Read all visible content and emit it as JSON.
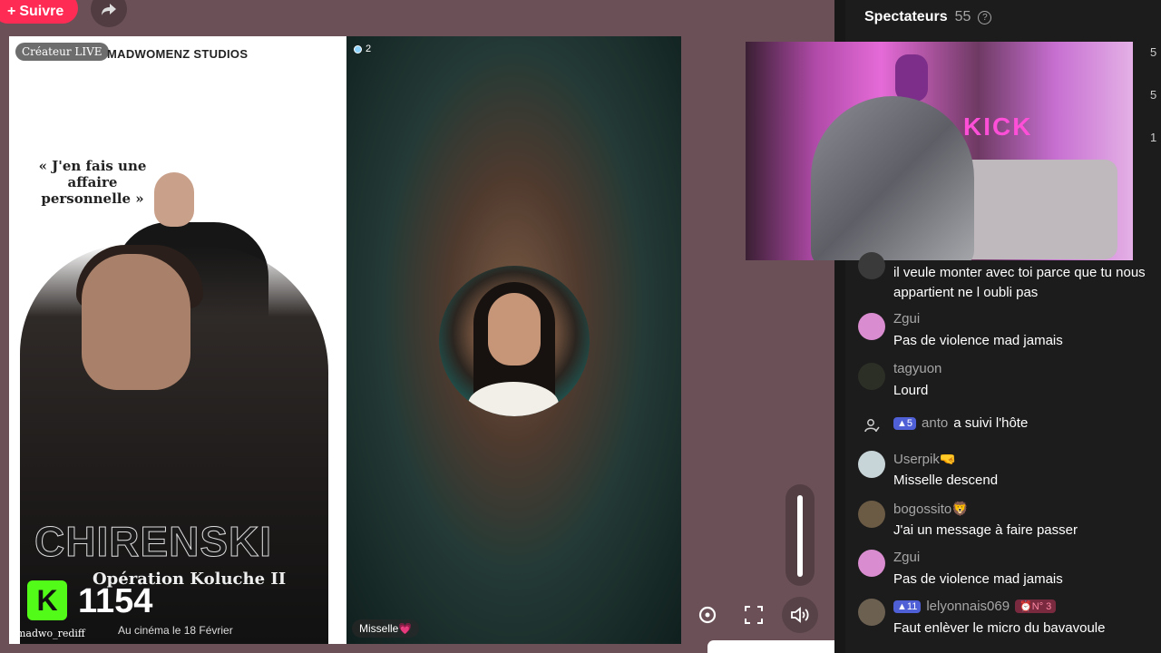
{
  "top": {
    "follow_label": "Suivre"
  },
  "stage_left": {
    "creator_badge": "Créateur LIVE",
    "studio": "MADWOMENZ STUDIOS",
    "quote": "« J'en fais une affaire personnelle »",
    "big_title": "CHIRENSKI",
    "subtitle": "Opération Koluche II",
    "release": "Au cinéma le 18 Février",
    "kick_letter": "K",
    "kick_count": "1154",
    "rediff": "madwo_rediff"
  },
  "stage_right": {
    "viewer_count": "2",
    "guest_name": "Misselle💗"
  },
  "panel": {
    "title": "Spectateurs",
    "viewer_count": "55",
    "rank_side": [
      "5",
      "5",
      "1"
    ]
  },
  "chat": [
    {
      "user": "",
      "text": "il veule monter avec toi parce que tu nous appartient ne l oubli pas",
      "avatar_color": "#3a3a3a"
    },
    {
      "user": "Zgui",
      "text": "Pas de violence mad jamais",
      "avatar_color": "#d98ccf"
    },
    {
      "user": "tagyuon",
      "text": "Lourd",
      "avatar_color": "#2c2f26"
    },
    {
      "follow": true,
      "level": "5",
      "user": "anto",
      "text": "a suivi l'hôte"
    },
    {
      "user": "Userpik🤜",
      "text": "Misselle descend",
      "avatar_color": "#c7d4d8"
    },
    {
      "user": "bogossito🦁",
      "text": "J'ai un message à faire passer",
      "avatar_color": "#6b5a44"
    },
    {
      "user": "Zgui",
      "text": "Pas de violence mad jamais",
      "avatar_color": "#d98ccf"
    },
    {
      "level": "11",
      "user": "lelyonnais069",
      "rank": "N° 3",
      "text": "Faut enlèver le micro du bavavoule",
      "avatar_color": "#6c6051"
    }
  ],
  "colors": {
    "follow": "#fe2c55",
    "kick": "#53fc18",
    "panel_bg": "#1c1c1c",
    "level_badge": "#4f5fd6"
  }
}
